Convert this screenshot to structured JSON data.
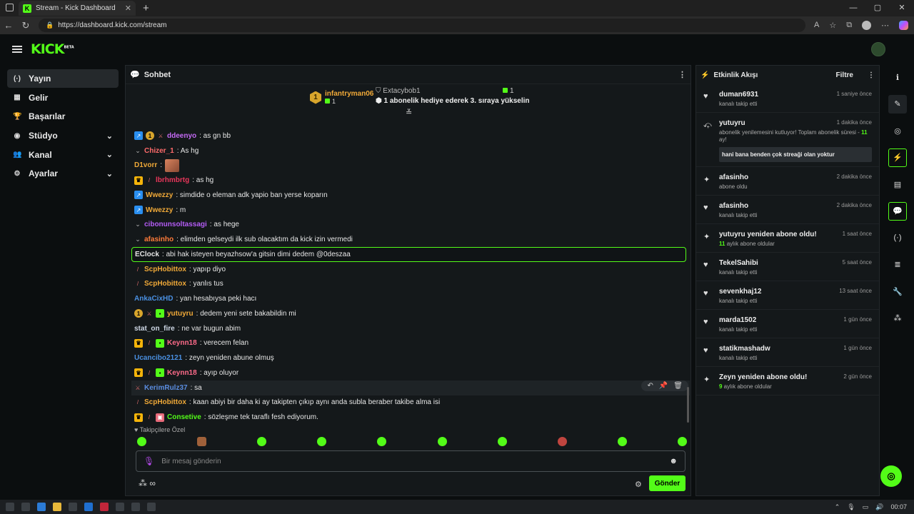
{
  "browser": {
    "tab_title": "Stream - Kick Dashboard",
    "url": "https://dashboard.kick.com/stream",
    "new_tab": "+",
    "controls": [
      "—",
      "▢",
      "✕"
    ]
  },
  "app": {
    "logo": "KICK",
    "logo_tag": "BETA"
  },
  "sidebar": {
    "items": [
      {
        "label": "Yayın",
        "icon": "broadcast-icon",
        "glyph": "(·)",
        "chevron": ""
      },
      {
        "label": "Gelir",
        "icon": "revenue-icon",
        "glyph": "▦",
        "chevron": ""
      },
      {
        "label": "Başarılar",
        "icon": "trophy-icon",
        "glyph": "🏆",
        "chevron": ""
      },
      {
        "label": "Stüdyo",
        "icon": "studio-icon",
        "glyph": "◉",
        "chevron": "⌄"
      },
      {
        "label": "Kanal",
        "icon": "channel-icon",
        "glyph": "👥",
        "chevron": "⌄"
      },
      {
        "label": "Ayarlar",
        "icon": "settings-icon",
        "glyph": "⚙",
        "chevron": "⌄"
      }
    ]
  },
  "chat": {
    "title": "Sohbet",
    "pinned": {
      "left_user": "infantryman06",
      "left_count": "1",
      "left_badge": "1",
      "right_user": "Extacybob1",
      "right_count": "1",
      "right_message": "1 abonelik hediye ederek 3. sıraya yükselin"
    },
    "messages": [
      {
        "badges": [
          "blue",
          "coin",
          "sword"
        ],
        "user": "ddeenyo",
        "color": "#c56af5",
        "text": ": as gn bb"
      },
      {
        "badges": [
          "chev"
        ],
        "user": "Chizer_1",
        "color": "#ff6b6b",
        "text": ": As hg"
      },
      {
        "badges": [],
        "user": "D1vorr",
        "color": "#f0a938",
        "text": ":",
        "emote": true
      },
      {
        "badges": [
          "gold",
          "pencil"
        ],
        "user": "lbrhmbrtg",
        "color": "#e8365a",
        "text": ": as hg"
      },
      {
        "badges": [
          "blue"
        ],
        "user": "Wwezzy",
        "color": "#f0a938",
        "text": ": simdide o eleman adk yapio ban yerse koparın"
      },
      {
        "badges": [
          "blue"
        ],
        "user": "Wwezzy",
        "color": "#f0a938",
        "text": ": m"
      },
      {
        "badges": [
          "chev"
        ],
        "user": "cibonunsoltassagi",
        "color": "#b45cf5",
        "text": ": as hege"
      },
      {
        "badges": [
          "chev"
        ],
        "user": "afasinho",
        "color": "#ff7b3a",
        "text": ": elimden gelseydi ilk sub olacaktım da kick izin vermedi"
      },
      {
        "badges": [],
        "user": "EClock",
        "color": "#e6e6e6",
        "text": ": abi hak isteyen beyazhsow'a gitsin dimi dedem @0deszaa",
        "highlight": true
      },
      {
        "badges": [
          "pencil"
        ],
        "user": "ScpHobittox",
        "color": "#f0a938",
        "text": ": yapıp diyo"
      },
      {
        "badges": [
          "pencil"
        ],
        "user": "ScpHobittox",
        "color": "#f0a938",
        "text": ": yanlıs tus"
      },
      {
        "badges": [],
        "user": "AnkaCixHD",
        "color": "#4a90e2",
        "text": ": yan hesabıysa peki hacı"
      },
      {
        "badges": [
          "coin",
          "sword",
          "green"
        ],
        "user": "yutuyru",
        "color": "#f0a938",
        "text": ": dedem yeni sete bakabildin mi"
      },
      {
        "badges": [],
        "user": "stat_on_fire",
        "color": "#cfd8e6",
        "text": ": ne var bugun abim"
      },
      {
        "badges": [
          "gold",
          "pencil",
          "green"
        ],
        "user": "Keynn18",
        "color": "#ff6b8a",
        "text": ": verecem felan"
      },
      {
        "badges": [],
        "user": "Ucancibo2121",
        "color": "#4a90e2",
        "text": ": zeyn yeniden abune olmuş"
      },
      {
        "badges": [
          "gold",
          "pencil",
          "green"
        ],
        "user": "Keynn18",
        "color": "#ff6b8a",
        "text": ": ayıp oluyor"
      },
      {
        "badges": [
          "xsword"
        ],
        "user": "KerimRulz37",
        "color": "#5b8de0",
        "text": ": sa",
        "hover": true
      },
      {
        "badges": [
          "pencil"
        ],
        "user": "ScpHobittox",
        "color": "#f0a938",
        "text": ": kaan abiyi bir daha ki ay takipten çıkıp aynı anda subla beraber takibe alma isi"
      },
      {
        "badges": [
          "gold",
          "pencil",
          "pink"
        ],
        "user": "Consetive",
        "color": "#53fc18",
        "text": ": sözleşme tek taraflı fesh ediyorum."
      }
    ],
    "follower_only": "♥ Takipçilere Özel",
    "input_placeholder": "Bir mesaj gönderin",
    "send_label": "Gönder",
    "footer_icons": "⁂ ∞"
  },
  "activity": {
    "title": "Etkinlik Akışı",
    "filter_label": "Filtre",
    "events": [
      {
        "icon": "heart-icon",
        "glyph": "♥",
        "name": "duman6931",
        "time": "1 saniye önce",
        "desc": "kanalı takip etti"
      },
      {
        "icon": "resub-icon",
        "glyph": "⤽",
        "name": "yutuyru",
        "time": "1 dakika önce",
        "desc": "abonelik yenilemesini kutluyor! Toplam abonelik süresi - ",
        "desc_green": "11",
        "desc_after": " ay!",
        "quote": "hani bana benden çok streaği olan yoktur"
      },
      {
        "icon": "sparkle-icon",
        "glyph": "✦",
        "name": "afasinho",
        "time": "2 dakika önce",
        "desc": "abone oldu"
      },
      {
        "icon": "heart-icon",
        "glyph": "♥",
        "name": "afasinho",
        "time": "2 dakika önce",
        "desc": "kanalı takip etti"
      },
      {
        "icon": "sparkle-icon",
        "glyph": "✦",
        "name": "yutuyru yeniden abone oldu!",
        "time": "1 saat önce",
        "desc_green": "11",
        "desc_after": " aylık abone oldular"
      },
      {
        "icon": "heart-icon",
        "glyph": "♥",
        "name": "TekelSahibi",
        "time": "5 saat önce",
        "desc": "kanalı takip etti"
      },
      {
        "icon": "heart-icon",
        "glyph": "♥",
        "name": "sevenkhaj12",
        "time": "13 saat önce",
        "desc": "kanalı takip etti"
      },
      {
        "icon": "heart-icon",
        "glyph": "♥",
        "name": "marda1502",
        "time": "1 gün önce",
        "desc": "kanalı takip etti"
      },
      {
        "icon": "heart-icon",
        "glyph": "♥",
        "name": "statikmashadw",
        "time": "1 gün önce",
        "desc": "kanalı takip etti"
      },
      {
        "icon": "sparkle-icon",
        "glyph": "✦",
        "name": "Zeyn yeniden abone oldu!",
        "time": "2 gün önce",
        "desc_green": "9",
        "desc_after": " aylık abone oldular"
      }
    ]
  },
  "rail": [
    {
      "name": "info-icon",
      "glyph": "ℹ",
      "state": ""
    },
    {
      "name": "edit-icon",
      "glyph": "✎",
      "state": "active"
    },
    {
      "name": "camera-icon",
      "glyph": "◎",
      "state": ""
    },
    {
      "name": "bolt-icon",
      "glyph": "⚡",
      "state": "on"
    },
    {
      "name": "notes-icon",
      "glyph": "▤",
      "state": ""
    },
    {
      "name": "chat-icon",
      "glyph": "💬",
      "state": "on"
    },
    {
      "name": "broadcast-icon",
      "glyph": "(·)",
      "state": ""
    },
    {
      "name": "layers-icon",
      "glyph": "≣",
      "state": ""
    },
    {
      "name": "wrench-icon",
      "glyph": "🔧",
      "state": ""
    },
    {
      "name": "share-icon",
      "glyph": "⁂",
      "state": ""
    }
  ],
  "taskbar": {
    "time": "00:07"
  },
  "colors": {
    "accent": "#53fc18"
  }
}
